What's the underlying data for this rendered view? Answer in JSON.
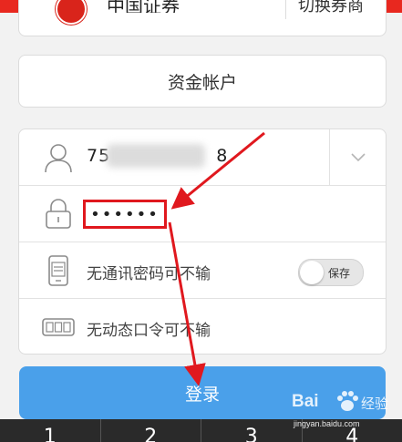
{
  "broker": {
    "name": "中国证券",
    "switch_label": "切换券商"
  },
  "account_type": "资金帐户",
  "account": {
    "value_prefix": "75",
    "value_suffix": "8"
  },
  "password": {
    "value": "••••••"
  },
  "comm_password": {
    "label": "无通讯密码可不输",
    "toggle_label": "保存",
    "toggle_on": false
  },
  "otp": {
    "label": "无动态口令可不输"
  },
  "login_label": "登录",
  "keyboard": {
    "keys": [
      "1",
      "2",
      "3",
      "4"
    ]
  },
  "watermark": {
    "brand": "Bai",
    "brand2": "经验",
    "url": "jingyan.baidu.com"
  },
  "colors": {
    "brand_red": "#e8281f",
    "highlight_red": "#e0181e",
    "login_blue": "#4aa0ea"
  }
}
